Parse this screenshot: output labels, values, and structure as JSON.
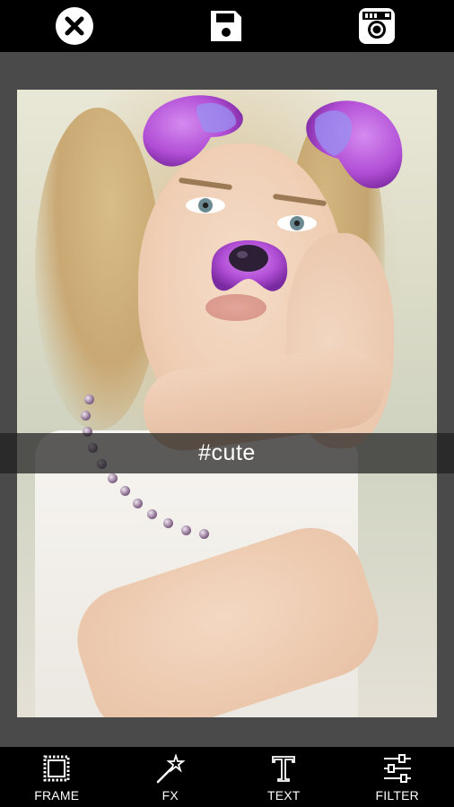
{
  "topbar": {
    "close_icon": "close-circle-icon",
    "save_icon": "save-disk-icon",
    "instagram_icon": "instagram-icon"
  },
  "caption": {
    "text": "#cute"
  },
  "toolbar": {
    "items": [
      {
        "label": "FRAME",
        "icon": "frame-icon"
      },
      {
        "label": "FX",
        "icon": "magic-wand-icon"
      },
      {
        "label": "TEXT",
        "icon": "text-icon"
      },
      {
        "label": "FILTER",
        "icon": "sliders-icon"
      }
    ]
  },
  "colors": {
    "bar_background": "#000000",
    "canvas_background": "#4a4a4a",
    "sticker_purple": "#b24fd6",
    "caption_bar": "#1e1e1e"
  }
}
